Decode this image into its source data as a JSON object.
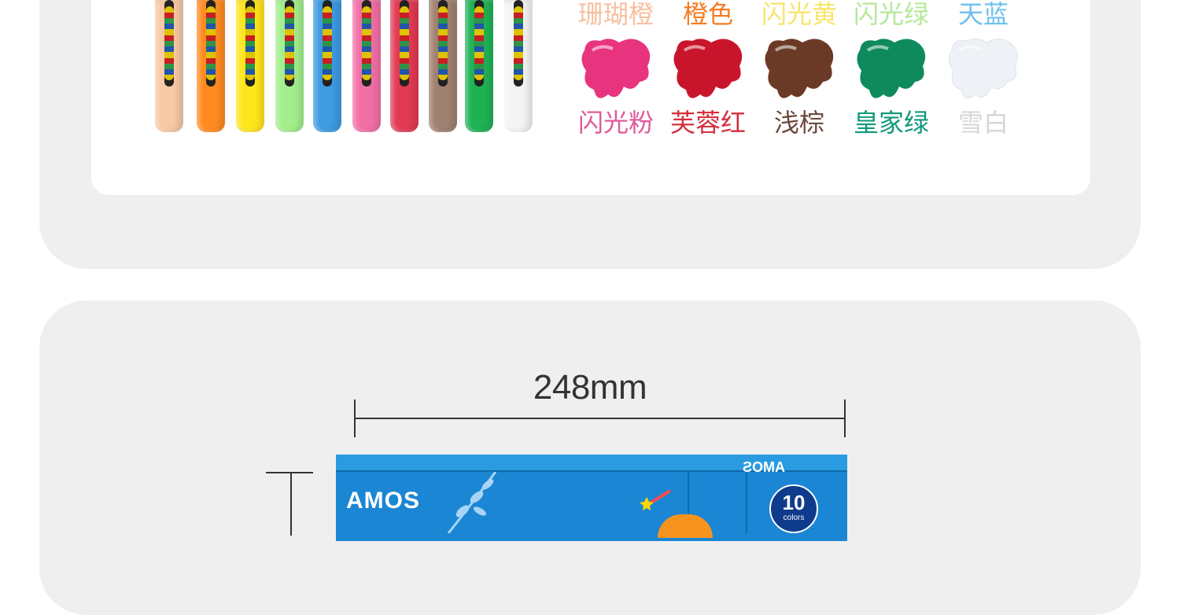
{
  "product": {
    "tube_colors": [
      "#f7c9a5",
      "#ff8a1f",
      "#ffe61c",
      "#a3ee8c",
      "#3d9be0",
      "#f26fa6",
      "#e23a52",
      "#a08070",
      "#1fb255",
      "#f4f4f4"
    ],
    "swatches_row1": [
      {
        "label": "珊瑚橙",
        "color": "#f7c0a0"
      },
      {
        "label": "橙色",
        "color": "#f57c23"
      },
      {
        "label": "闪光黄",
        "color": "#f7e56a"
      },
      {
        "label": "闪光绿",
        "color": "#b5e89a"
      },
      {
        "label": "天蓝",
        "color": "#6ec0ef"
      }
    ],
    "swatches_row2": [
      {
        "label": "闪光粉",
        "color": "#e8347e",
        "label_color": "#e05a9a"
      },
      {
        "label": "芙蓉红",
        "color": "#c9152c",
        "label_color": "#d4303e"
      },
      {
        "label": "浅棕",
        "color": "#6b3a27",
        "label_color": "#6b4a3e"
      },
      {
        "label": "皇家绿",
        "color": "#0e8a5c",
        "label_color": "#10987a"
      },
      {
        "label": "雪白",
        "color": "#eef1f5",
        "label_color": "#d6d6d6"
      }
    ]
  },
  "dimensions": {
    "width_label": "248mm"
  },
  "box": {
    "brand": "AMOS",
    "count": "10",
    "count_unit": "colors",
    "mirror_brand": "AMOS"
  }
}
